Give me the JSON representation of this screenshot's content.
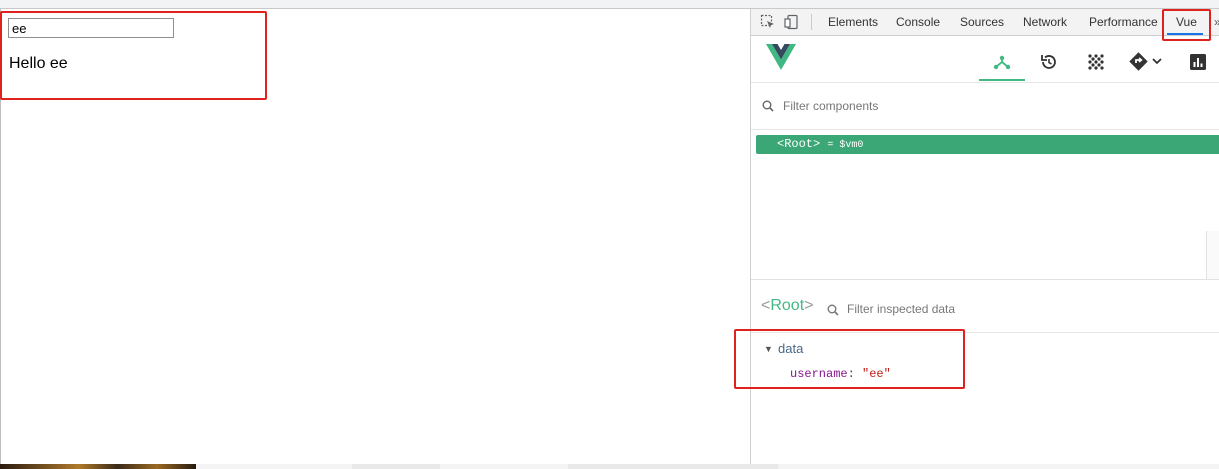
{
  "app": {
    "input_value": "ee",
    "greeting": "Hello ee"
  },
  "devtools": {
    "tabs": [
      "Elements",
      "Console",
      "Sources",
      "Network",
      "Performance",
      "Vue"
    ],
    "active_tab": "Vue",
    "overflow_glyph": "»"
  },
  "vue_panel": {
    "filter_components_placeholder": "Filter components",
    "tree": {
      "root_tag": "<Root>",
      "root_ref": "= $vm0"
    },
    "inspector": {
      "component_name": "Root",
      "filter_placeholder": "Filter inspected data",
      "section_label": "data",
      "prop_key": "username",
      "prop_value": "\"ee\""
    }
  },
  "icons": {
    "inspect": "inspect-element-icon",
    "device": "device-toolbar-icon",
    "vue_logo": "vue-logo-icon",
    "components": "components-tree-icon",
    "history": "history-icon",
    "vuex": "vuex-icon",
    "router": "router-icon",
    "performance": "performance-chart-icon",
    "search": "search-icon"
  },
  "colors": {
    "vue_green": "#42b983",
    "selected_row": "#3ba776",
    "annotation_red": "#e0221f",
    "active_tab_underline": "#1a73e8"
  }
}
